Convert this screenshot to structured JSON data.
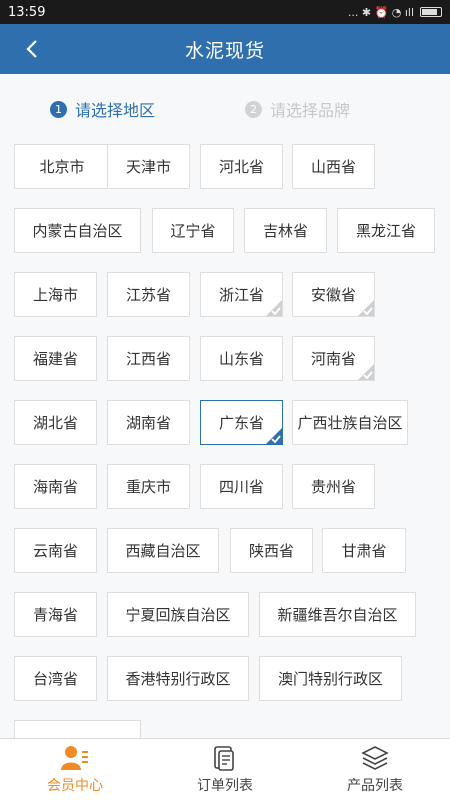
{
  "status_bar": {
    "time": "13:59",
    "indicators": "... ✱ ⏰ ◔ ıll"
  },
  "header": {
    "title": "水泥现货"
  },
  "steps": [
    {
      "num": "1",
      "label": "请选择地区",
      "active": true
    },
    {
      "num": "2",
      "label": "请选择品牌",
      "active": false
    }
  ],
  "regions": [
    "北京市",
    "天津市",
    "河北省",
    "山西省",
    "内蒙古自治区",
    "辽宁省",
    "吉林省",
    "黑龙江省",
    "上海市",
    "江苏省",
    "浙江省",
    "安徽省",
    "福建省",
    "江西省",
    "山东省",
    "河南省",
    "湖北省",
    "湖南省",
    "广东省",
    "广西壮族自治区",
    "海南省",
    "重庆市",
    "四川省",
    "贵州省",
    "云南省",
    "西藏自治区",
    "陕西省",
    "甘肃省",
    "青海省",
    "宁夏回族自治区",
    "新疆维吾尔自治区",
    "台湾省",
    "香港特别行政区",
    "澳门特别行政区",
    ""
  ],
  "checked_regions": [
    "浙江省",
    "安徽省",
    "河南省"
  ],
  "selected_region": "广东省",
  "tabs": [
    {
      "label": "会员中心",
      "icon": "member-icon",
      "active": true
    },
    {
      "label": "订单列表",
      "icon": "order-icon",
      "active": false
    },
    {
      "label": "产品列表",
      "icon": "product-layers-icon",
      "active": false
    }
  ],
  "colors": {
    "primary": "#2f6fae",
    "accent": "#f08a24"
  }
}
